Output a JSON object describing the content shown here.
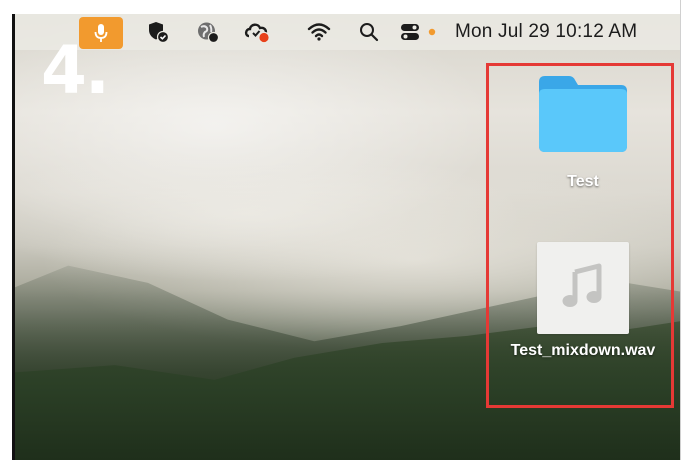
{
  "step": {
    "number": "4."
  },
  "menubar": {
    "icons": [
      "microphone-icon",
      "shield-check-icon",
      "globe-icon",
      "cloud-record-icon",
      "wifi-icon",
      "search-icon",
      "control-center-icon",
      "status-dot-icon"
    ],
    "clock": "Mon Jul 29  10:12 AM",
    "accent_color": "#f29a2e"
  },
  "desktop": {
    "items": [
      {
        "label": "Test",
        "icon": "folder-icon",
        "color": "#5ac8fa"
      },
      {
        "label": "Test_mixdown.wav",
        "icon": "music-note-icon"
      }
    ]
  },
  "highlight": {
    "color": "#e53935"
  }
}
